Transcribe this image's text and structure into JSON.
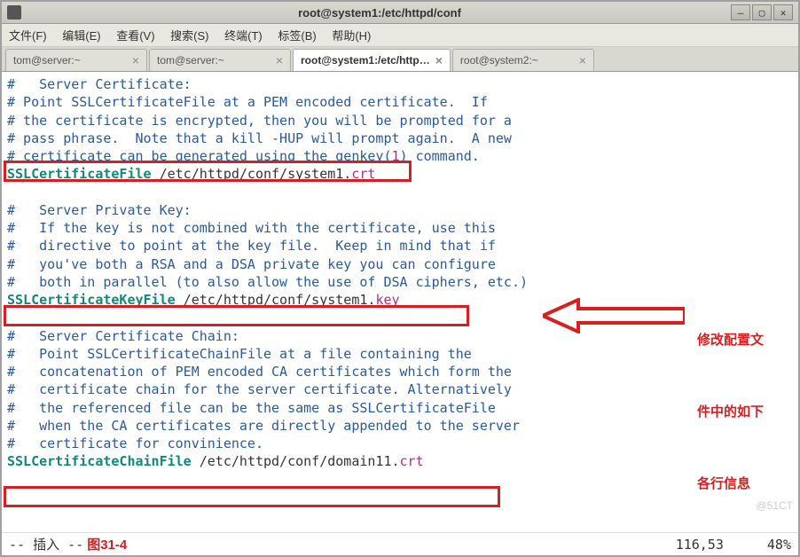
{
  "window": {
    "title": "root@system1:/etc/httpd/conf"
  },
  "menubar": {
    "items": [
      "文件(F)",
      "编辑(E)",
      "查看(V)",
      "搜索(S)",
      "终端(T)",
      "标签(B)",
      "帮助(H)"
    ]
  },
  "tabs": [
    {
      "label": "tom@server:~",
      "active": false
    },
    {
      "label": "tom@server:~",
      "active": false
    },
    {
      "label": "root@system1:/etc/http…",
      "active": true
    },
    {
      "label": "root@system2:~",
      "active": false
    }
  ],
  "content": {
    "block1": {
      "l1": "#   Server Certificate:",
      "l2": "# Point SSLCertificateFile at a PEM encoded certificate.  If",
      "l3": "# the certificate is encrypted, then you will be prompted for a",
      "l4": "# pass phrase.  Note that a kill -HUP will prompt again.  A new",
      "l5_a": "# certificate can be generated using the genkey(",
      "l5_num": "1",
      "l5_b": ") command."
    },
    "directive1": {
      "name": "SSLCertificateFile",
      "path": " /etc/httpd/conf/system1.",
      "ext": "crt"
    },
    "block2": {
      "l1": "#   Server Private Key:",
      "l2": "#   If the key is not combined with the certificate, use this",
      "l3": "#   directive to point at the key file.  Keep in mind that if",
      "l4": "#   you've both a RSA and a DSA private key you can configure",
      "l5": "#   both in parallel (to also allow the use of DSA ciphers, etc.)"
    },
    "directive2": {
      "name": "SSLCertificateKeyFile",
      "path": " /etc/httpd/conf/system1.",
      "ext": "key"
    },
    "block3": {
      "l1": "#   Server Certificate Chain:",
      "l2": "#   Point SSLCertificateChainFile at a file containing the",
      "l3": "#   concatenation of PEM encoded CA certificates which form the",
      "l4": "#   certificate chain for the server certificate. Alternatively",
      "l5": "#   the referenced file can be the same as SSLCertificateFile",
      "l6": "#   when the CA certificates are directly appended to the server",
      "l7": "#   certificate for convinience."
    },
    "directive3": {
      "name": "SSLCertificateChainFile",
      "path": " /etc/httpd/conf/domain11.",
      "ext": "crt"
    }
  },
  "annotation": {
    "line1": "修改配置文",
    "line2": "件中的如下",
    "line3": "各行信息"
  },
  "statusbar": {
    "mode": "-- 插入 --",
    "figlabel": "图31-4",
    "position": "116,53",
    "percent": "48%"
  },
  "watermark": "@51CT"
}
